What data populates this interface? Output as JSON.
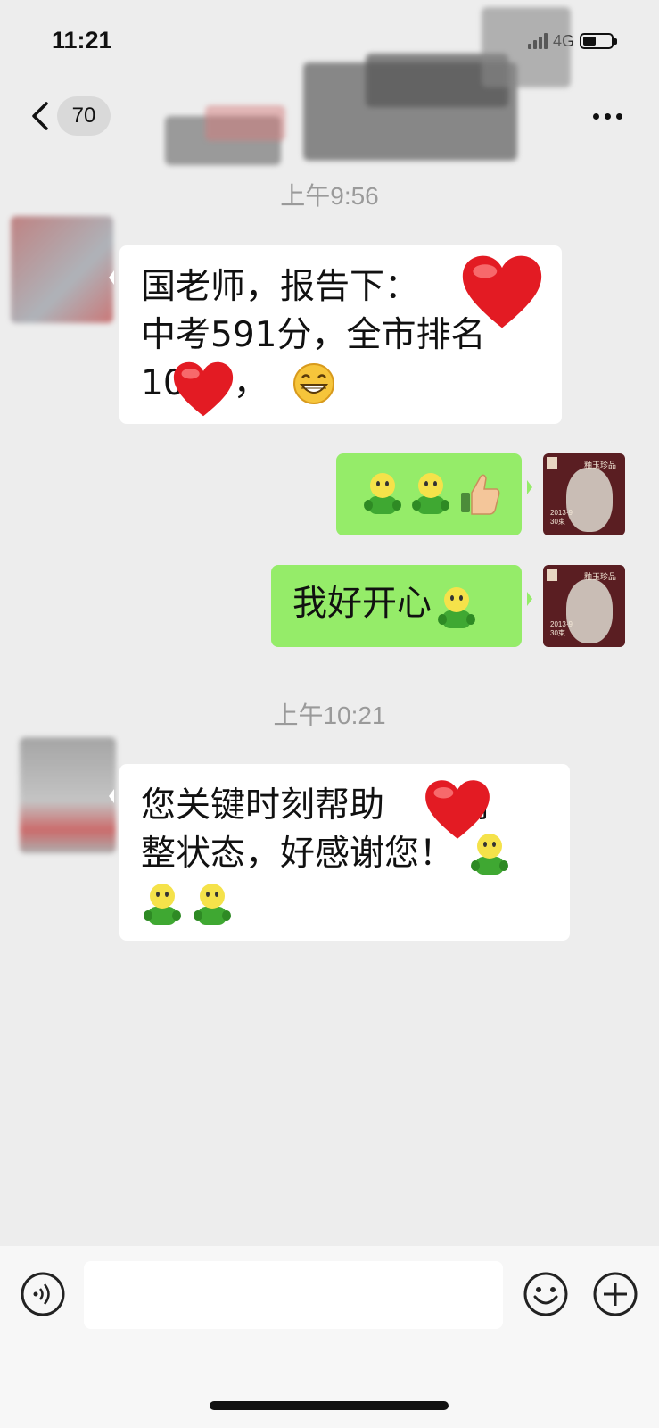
{
  "status_bar": {
    "time": "11:21",
    "network": "4G",
    "battery_level": 0.45
  },
  "nav": {
    "unread_count": "70",
    "back_icon": "chevron-left-icon",
    "more_icon": "ellipsis-icon"
  },
  "messages": [
    {
      "type": "timestamp",
      "text": "上午9:56"
    },
    {
      "type": "incoming",
      "lines": [
        "国老师，报告下：",
        "中考591分，全市排名",
        "10",
        "，"
      ],
      "emojis": [
        "heart",
        "heart",
        "grinning-face"
      ]
    },
    {
      "type": "outgoing",
      "emojis": [
        "green-person",
        "green-person",
        "thumbs-up"
      ]
    },
    {
      "type": "outgoing",
      "text": "我好开心",
      "emojis": [
        "green-person"
      ]
    },
    {
      "type": "timestamp",
      "text": "上午10:21"
    },
    {
      "type": "incoming",
      "lines": [
        "您关键时刻帮助",
        "调",
        "整状态，好感谢您！"
      ],
      "emojis": [
        "heart",
        "green-person",
        "green-person",
        "green-person"
      ]
    }
  ],
  "my_avatar": {
    "caption": "釉玉珍品",
    "date": "2013·9",
    "sub": "30束"
  },
  "input_bar": {
    "voice_icon": "voice-icon",
    "emoji_icon": "smiley-icon",
    "plus_icon": "plus-icon"
  }
}
